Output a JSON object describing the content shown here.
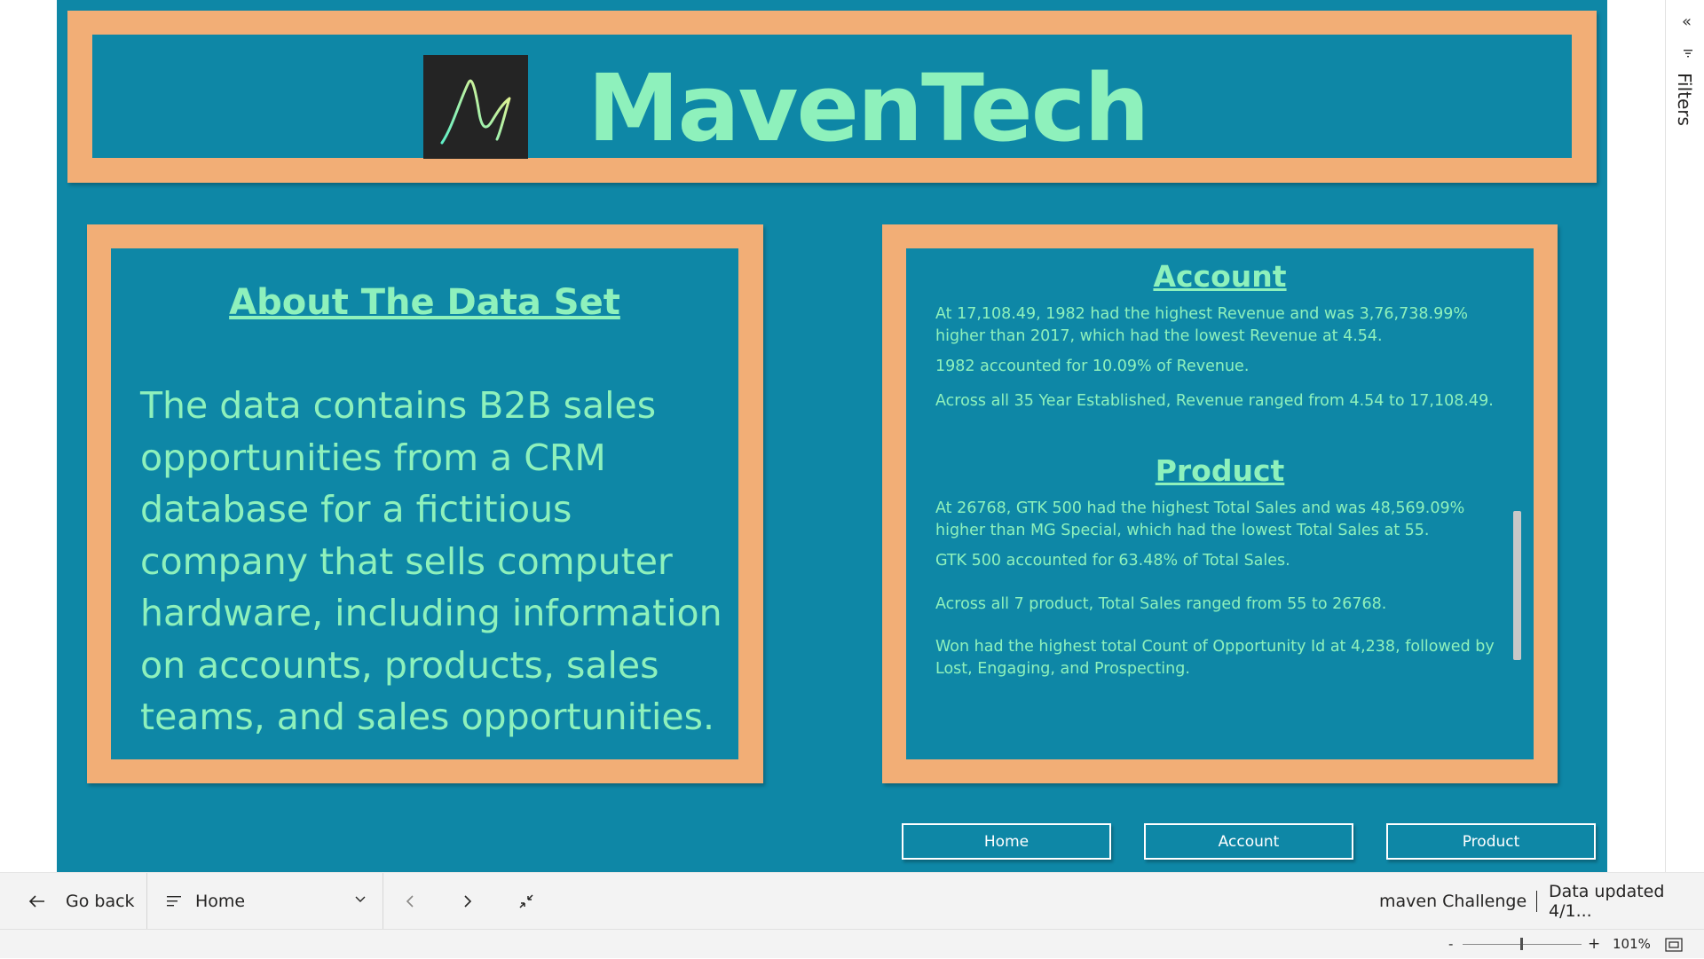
{
  "header": {
    "brand": "MavenTech",
    "logo_icon": "maven-wave-logo-icon"
  },
  "about": {
    "title": "About The Data Set",
    "body": "The data contains B2B sales opportunities from a CRM database for a fictitious company that sells computer hardware, including information on accounts, products, sales teams, and sales opportunities."
  },
  "insights": {
    "account_heading": "Account",
    "account_lines": [
      "At 17,108.49, 1982 had the highest  Revenue and was 3,76,738.99% higher than 2017, which had the lowest  Revenue at 4.54.",
      "1982 accounted for 10.09% of  Revenue.",
      "Across all 35 Year Established,  Revenue ranged from 4.54 to 17,108.49."
    ],
    "product_heading": "Product",
    "product_lines": [
      "At 26768, GTK 500 had the highest Total Sales and was 48,569.09% higher than MG Special, which had the lowest Total Sales at 55.",
      "GTK 500 accounted for 63.48% of Total Sales.",
      "Across all 7 product, Total Sales ranged from 55 to 26768.",
      "Won had the highest total Count of Opportunity Id at 4,238, followed by Lost, Engaging, and Prospecting."
    ]
  },
  "nav": {
    "home": "Home",
    "account": "Account",
    "product": "Product"
  },
  "filters_pane": {
    "label": "Filters",
    "collapse_icon": "«"
  },
  "bottom_bar": {
    "go_back": "Go back",
    "page_select": "Home",
    "workspace": "maven Challenge",
    "data_updated": "Data updated 4/1..."
  },
  "zoom": {
    "minus": "-",
    "plus": "+",
    "level": "101%"
  },
  "colors": {
    "canvas": "#0e87a6",
    "frame": "#f2ae76",
    "accent_text": "#8ef1bc"
  }
}
